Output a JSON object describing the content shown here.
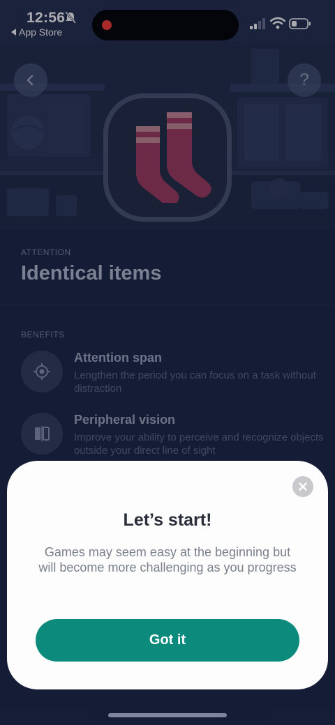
{
  "status_bar": {
    "time": "12:56",
    "back_app": "App Store"
  },
  "hero": {
    "icons": {
      "back": "chevron-left-icon",
      "help": "question-mark",
      "game": "socks-icon"
    },
    "help_label": "?"
  },
  "game": {
    "category": "ATTENTION",
    "title": "Identical items"
  },
  "benefits": {
    "heading": "BENEFITS",
    "items": [
      {
        "icon": "target-icon",
        "title": "Attention span",
        "description": "Lengthen the period you can focus on a task without distraction"
      },
      {
        "icon": "peripheral-vision-icon",
        "title": "Peripheral vision",
        "description": "Improve your ability to perceive and recognize objects outside your direct line of sight"
      }
    ]
  },
  "modal": {
    "title": "Let’s start!",
    "body": "Games may seem easy at the beginning but will become more challenging as you progress",
    "button_label": "Got it"
  },
  "colors": {
    "background": "#1d2544",
    "accent": "#0c8b7d",
    "sock": "#a43a5e",
    "sock_stripe": "#c98b95"
  }
}
